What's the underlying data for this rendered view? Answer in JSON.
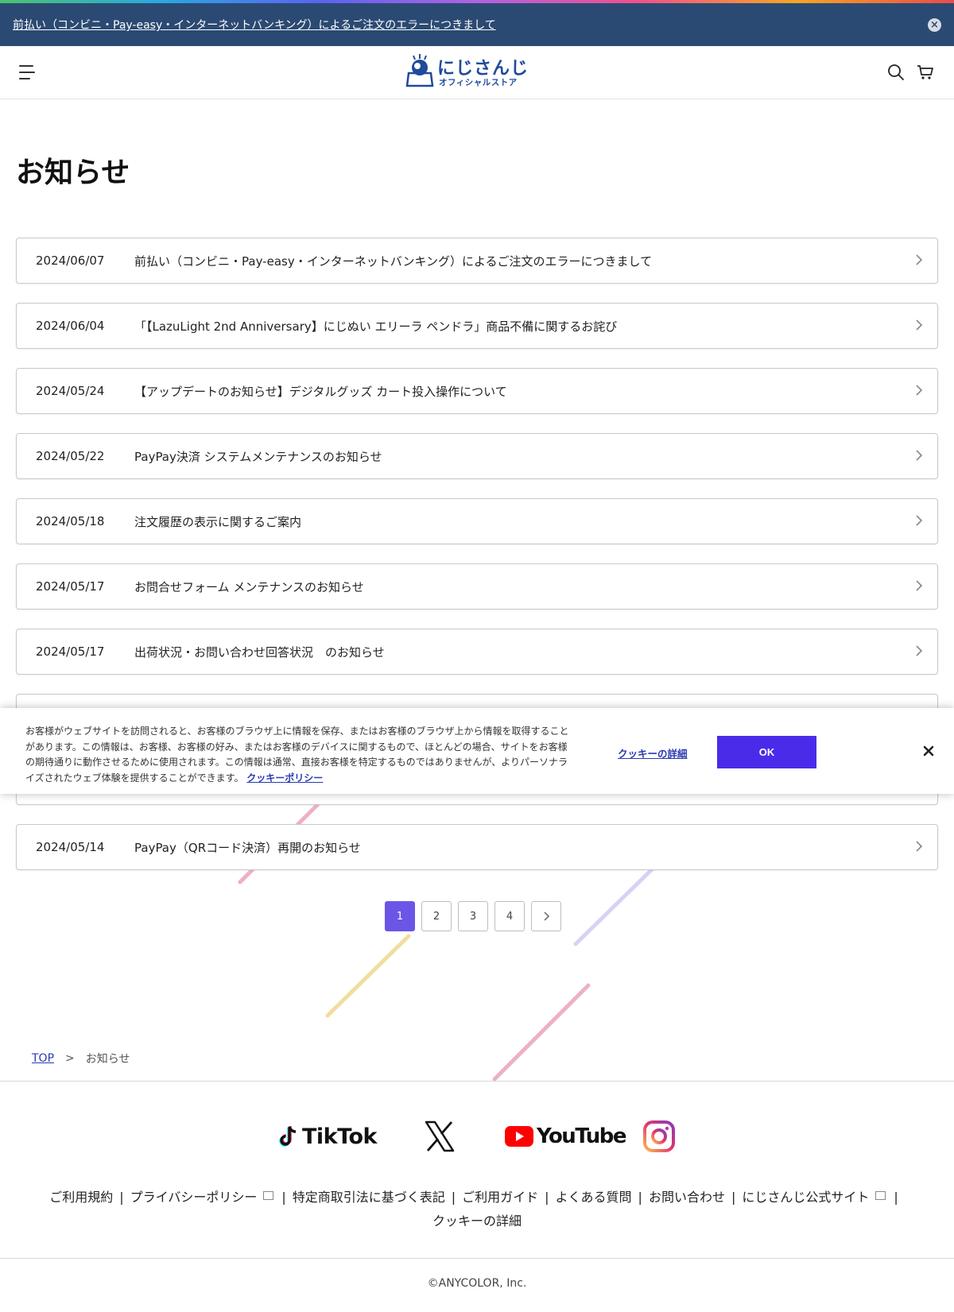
{
  "announcement": {
    "text": "前払い（コンビニ・Pay-easy・インターネットバンキング）によるご注文のエラーにつきまして",
    "close_icon": "×"
  },
  "header": {
    "logo_main": "にじさんじ",
    "logo_sub": "オフィシャルストア"
  },
  "page_title": "お知らせ",
  "news": [
    {
      "date": "2024/06/07",
      "title": "前払い（コンビニ・Pay-easy・インターネットバンキング）によるご注文のエラーにつきまして"
    },
    {
      "date": "2024/06/04",
      "title": "「【LazuLight 2nd Anniversary】にじぬい エリーラ ペンドラ」商品不備に関するお詫び"
    },
    {
      "date": "2024/05/24",
      "title": "【アップデートのお知らせ】デジタルグッズ カート投入操作について"
    },
    {
      "date": "2024/05/22",
      "title": "PayPay決済 システムメンテナンスのお知らせ"
    },
    {
      "date": "2024/05/18",
      "title": "注文履歴の表示に関するご案内"
    },
    {
      "date": "2024/05/17",
      "title": "お問合せフォーム メンテナンスのお知らせ"
    },
    {
      "date": "2024/05/17",
      "title": "出荷状況・お問い合わせ回答状況　のお知らせ"
    },
    {
      "date": "",
      "title": ""
    },
    {
      "date": "",
      "title": ""
    },
    {
      "date": "2024/05/14",
      "title": "PayPay（QRコード決済）再開のお知らせ"
    }
  ],
  "cookie_banner": {
    "text": "お客様がウェブサイトを訪問されると、お客様のブラウザ上に情報を保存、またはお客様のブラウザ上から情報を取得することがあります。この情報は、お客様、お客様の好み、またはお客様のデバイスに関するもので、ほとんどの場合、サイトをお客様の期待通りに動作させるために使用されます。この情報は通常、直接お客様を特定するものではありませんが、よりパーソナライズされたウェブ体験を提供することができます。",
    "policy_link": "クッキーポリシー",
    "details_link": "クッキーの詳細",
    "ok_label": "OK"
  },
  "pagination": {
    "pages": [
      "1",
      "2",
      "3",
      "4"
    ],
    "current": "1"
  },
  "breadcrumb": {
    "home": "TOP",
    "separator": ">",
    "current": "お知らせ"
  },
  "social": {
    "tiktok": "TikTok",
    "youtube": "YouTube"
  },
  "footer": {
    "links": [
      "ご利用規約",
      "プライバシーポリシー",
      "特定商取引法に基づく表記",
      "ご利用ガイド",
      "よくある質問",
      "お問い合わせ",
      "にじさんじ公式サイト",
      "クッキーの詳細"
    ],
    "copyright": "©ANYCOLOR, Inc."
  },
  "colors": {
    "accent": "#6a55e6",
    "topbar": "#2b4a73",
    "ok_button": "#4b2bea",
    "link": "#2a3bb0"
  }
}
